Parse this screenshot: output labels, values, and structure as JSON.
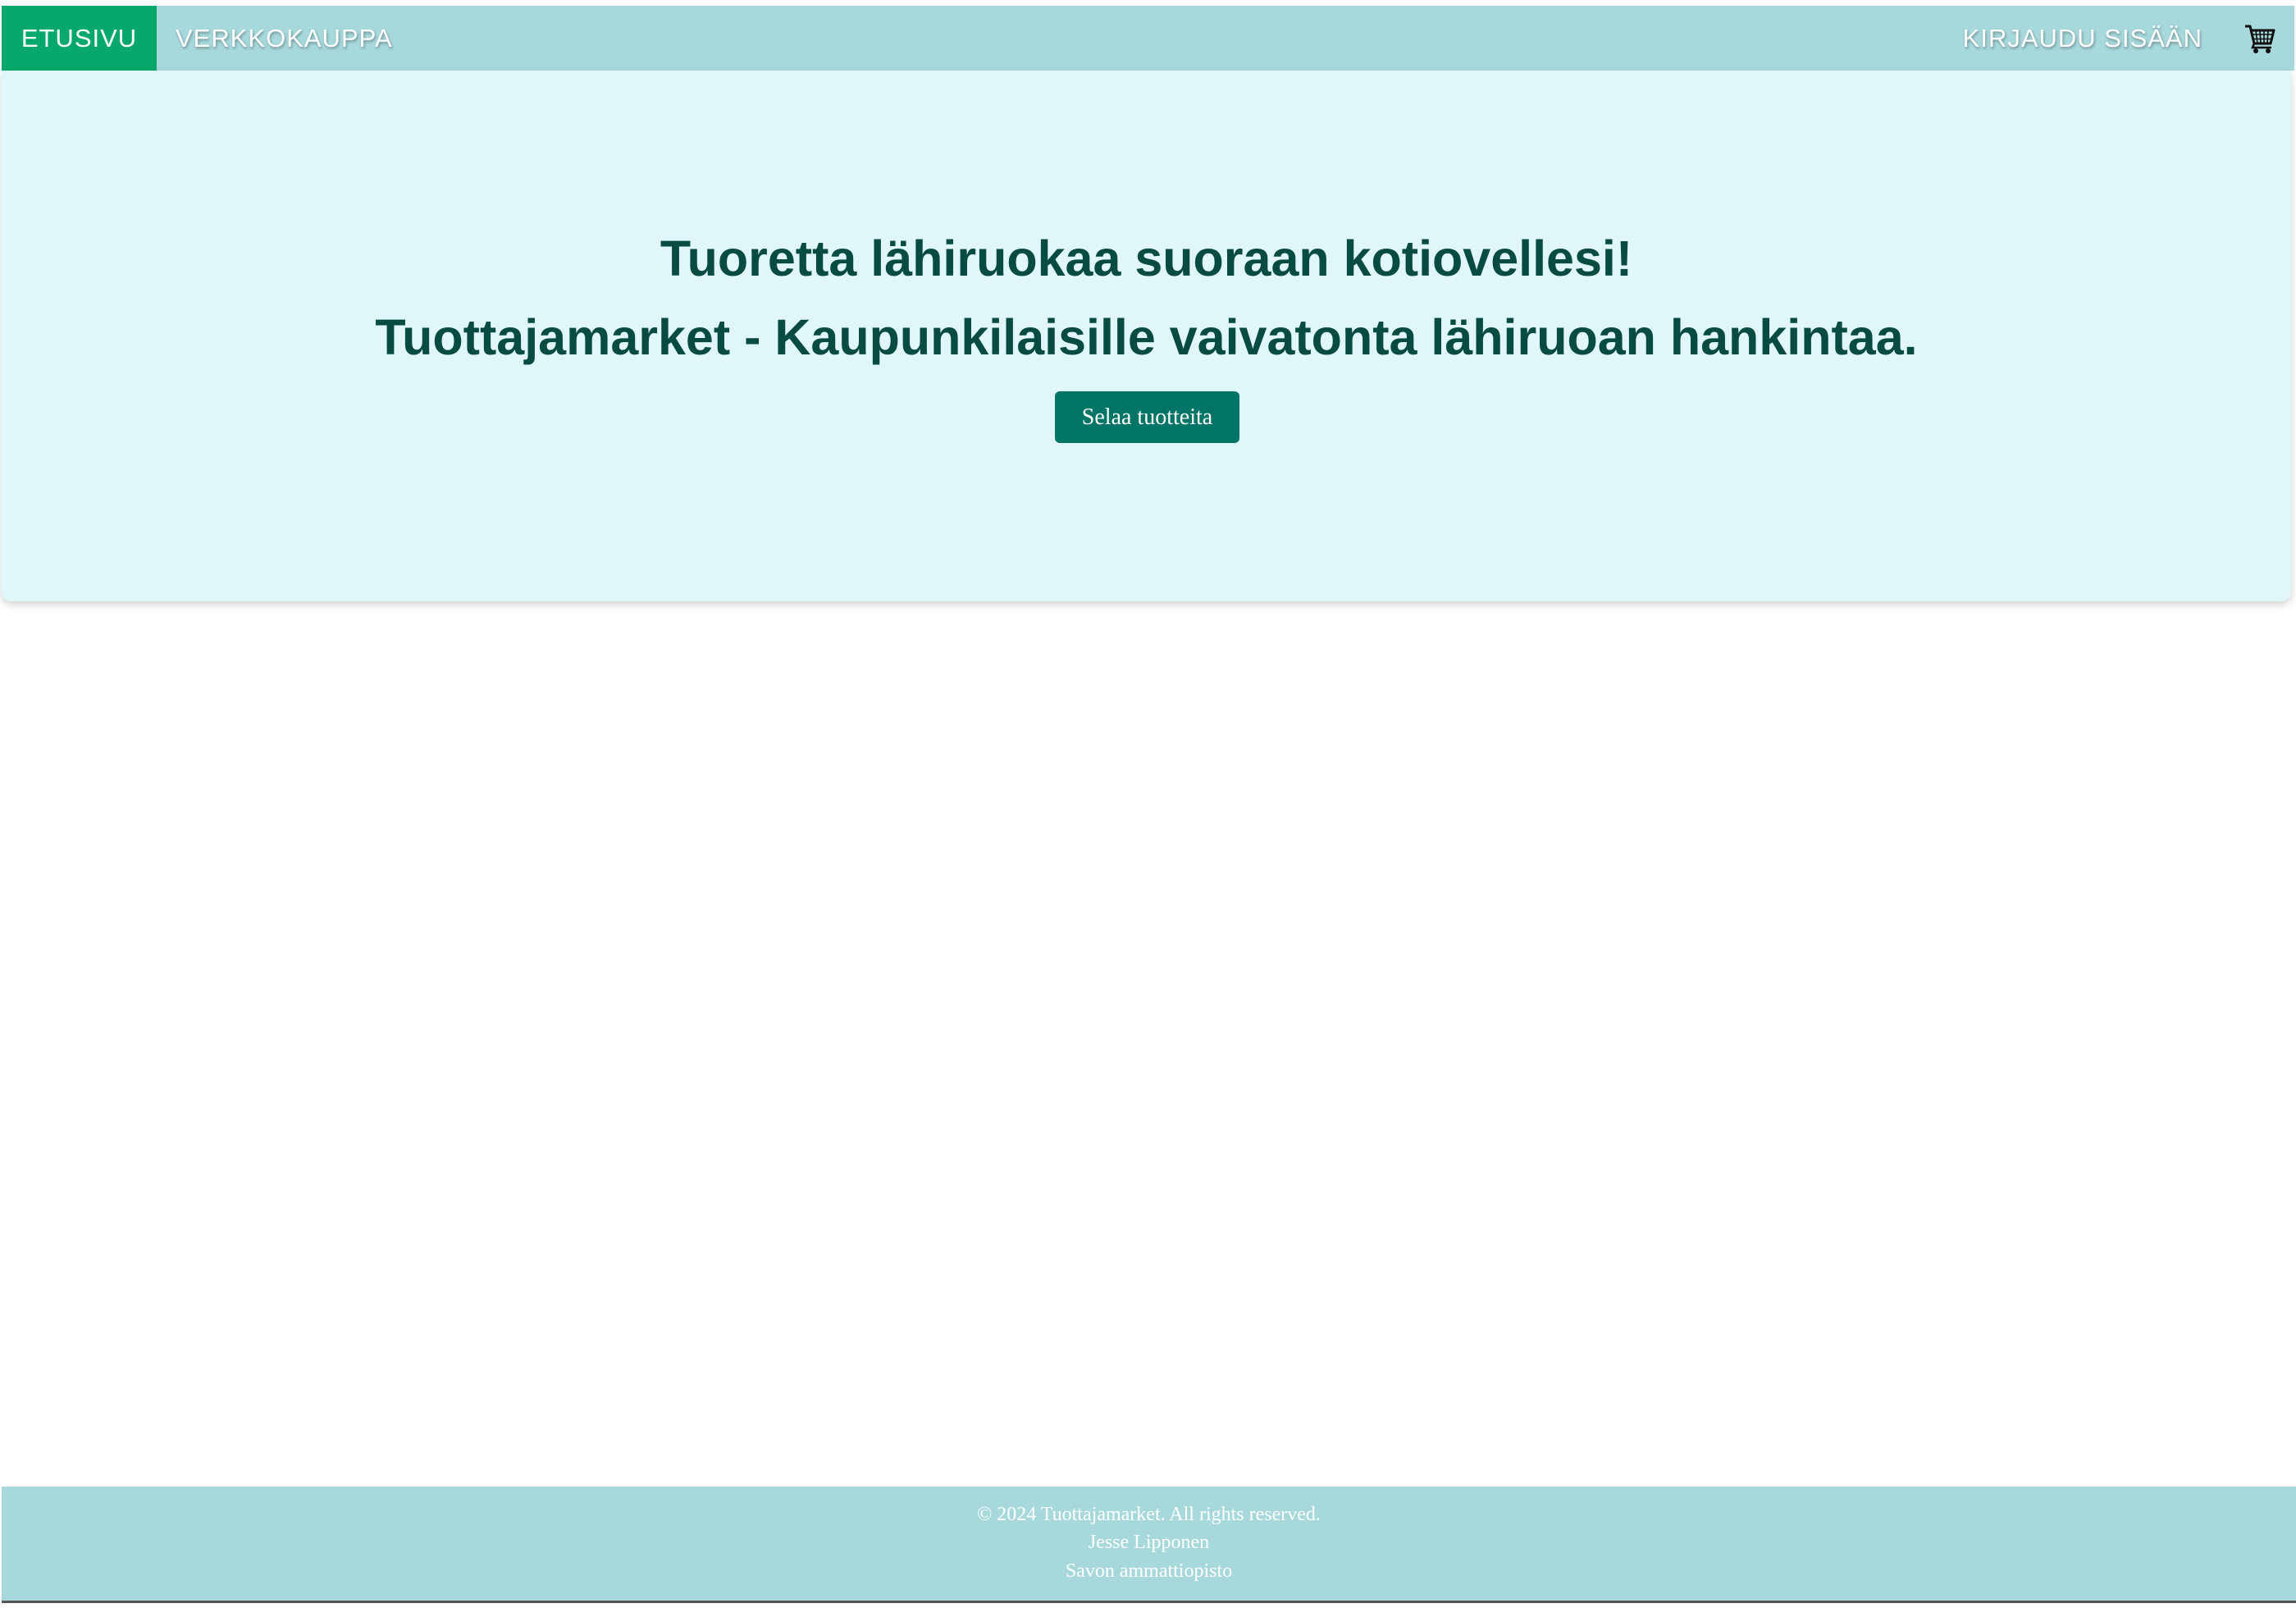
{
  "nav": {
    "home_label": "ETUSIVU",
    "shop_label": "VERKKOKAUPPA",
    "login_label": "KIRJAUDU SISÄÄN",
    "cart_icon": "shopping-cart-icon"
  },
  "hero": {
    "title_line1": "Tuoretta lähiruokaa suoraan kotiovellesi!",
    "title_line2": "Tuottajamarket - Kaupunkilaisille vaivatonta lähiruoan hankintaa.",
    "button_label": "Selaa tuotteita"
  },
  "footer": {
    "copyright": "© 2024 Tuottajamarket. All rights reserved.",
    "author": "Jesse Lipponen",
    "school": "Savon ammattiopisto"
  },
  "colors": {
    "nav_background": "#a6d8dc",
    "nav_active": "#06a86b",
    "hero_background": "#e0f6f8",
    "hero_text": "#074b43",
    "button_background": "#037566"
  }
}
